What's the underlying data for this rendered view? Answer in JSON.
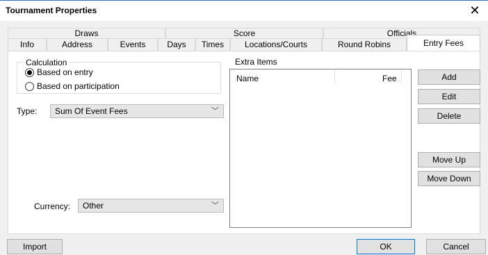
{
  "window": {
    "title": "Tournament Properties",
    "close_glyph": "✕"
  },
  "tabs_back": [
    "Draws",
    "Score",
    "Officials"
  ],
  "tabs_front": [
    "Info",
    "Address",
    "Events",
    "Days",
    "Times",
    "Locations/Courts",
    "Round Robins",
    "Entry Fees"
  ],
  "calculation": {
    "label": "Calculation",
    "options": [
      "Based on entry",
      "Based on participation"
    ],
    "selected": "Based on entry"
  },
  "type": {
    "label": "Type:",
    "value": "Sum Of Event Fees"
  },
  "currency": {
    "label": "Currency:",
    "value": "Other"
  },
  "extra_items": {
    "label": "Extra Items",
    "columns": [
      "Name",
      "Fee"
    ]
  },
  "buttons": {
    "add": "Add",
    "edit": "Edit",
    "delete": "Delete",
    "move_up": "Move Up",
    "move_down": "Move Down",
    "import": "Import",
    "ok": "OK",
    "cancel": "Cancel"
  },
  "icons": {
    "dropdown": "chevron-down-icon",
    "close": "close-icon"
  },
  "colors": {
    "accent": "#0078d7",
    "title_border": "#2b6cc4"
  }
}
